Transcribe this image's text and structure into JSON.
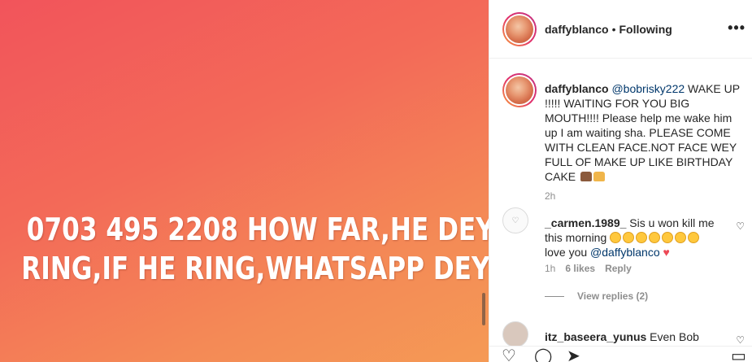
{
  "post": {
    "overlay_line1": "0703 495 2208 HOW FAR,HE DEY",
    "overlay_line2": "RING,IF HE  RING,WHATSAPP DEY O"
  },
  "header": {
    "username": "daffyblanco",
    "separator": "•",
    "following": "Following",
    "more": "•••"
  },
  "caption": {
    "username": "daffyblanco",
    "mention": "@bobrisky222",
    "text": " WAKE UP !!!!! WAITING FOR YOU BIG MOUTH!!!! Please help me wake him up I am waiting sha. PLEASE COME WITH CLEAN FACE.NOT FACE WEY FULL OF MAKE UP LIKE BIRTHDAY CAKE ",
    "time": "2h"
  },
  "comments": [
    {
      "username": "_carmen.1989_",
      "text1": " Sis u won kill me this morning ",
      "text2": " love you ",
      "mention": "@daffyblanco",
      "time": "1h",
      "likes": "6 likes",
      "reply": "Reply",
      "view_replies": "View replies (2)"
    },
    {
      "username": "itz_baseera_yunus",
      "text": " Even Bob"
    }
  ],
  "icons": {
    "like": "heart-icon",
    "comment": "comment-icon",
    "share": "share-icon",
    "save": "bookmark-icon"
  }
}
